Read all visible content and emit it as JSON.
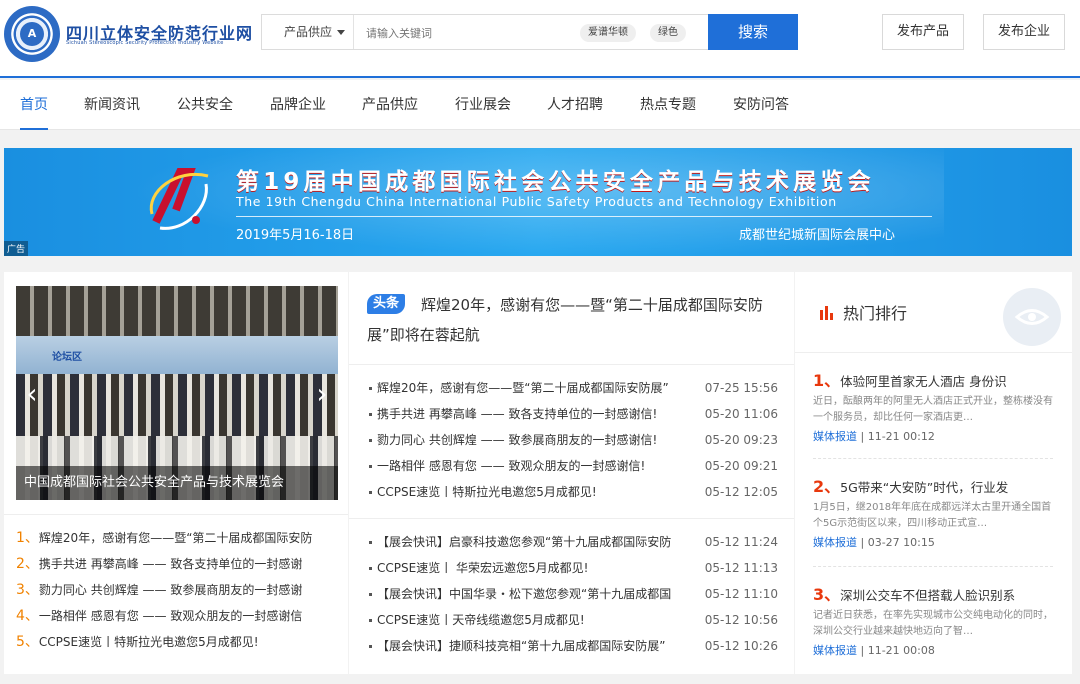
{
  "header": {
    "site_title": "四川立体安全防范行业网",
    "site_subtitle": "Sichuan Stereoscopic Security Protection Industry Website",
    "search": {
      "category": "产品供应",
      "placeholder": "请输入关键词",
      "tags": [
        "爱谱华顿",
        "绿色"
      ],
      "button": "搜索"
    },
    "publish_product": "发布产品",
    "publish_company": "发布企业"
  },
  "nav": {
    "items": [
      "首页",
      "新闻资讯",
      "公共安全",
      "品牌企业",
      "产品供应",
      "行业展会",
      "人才招聘",
      "热点专题",
      "安防问答"
    ],
    "active_index": 0
  },
  "banner": {
    "title": "第19届中国成都国际社会公共安全产品与技术展览会",
    "subtitle_en": "The 19th Chengdu China International Public Safety Products and Technology Exhibition",
    "date": "2019年5月16-18日",
    "venue": "成都世纪城新国际会展中心",
    "ad_label": "广告"
  },
  "feature": {
    "caption": "中国成都国际社会公共安全产品与技术展览会",
    "wall_text": "论坛区"
  },
  "rank_list": [
    {
      "num": "1、",
      "text": "辉煌20年，感谢有您——暨“第二十届成都国际安防"
    },
    {
      "num": "2、",
      "text": "携手共进 再攀高峰 —— 致各支持单位的一封感谢"
    },
    {
      "num": "3、",
      "text": "勠力同心 共创辉煌 —— 致参展商朋友的一封感谢"
    },
    {
      "num": "4、",
      "text": "一路相伴 感恩有您 —— 致观众朋友的一封感谢信"
    },
    {
      "num": "5、",
      "text": "CCPSE速览丨特斯拉光电邀您5月成都见!"
    }
  ],
  "headline": {
    "badge": "头条",
    "text": "辉煌20年，感谢有您——暨“第二十届成都国际安防展”即将在蓉起航"
  },
  "news_top": [
    {
      "title": "辉煌20年，感谢有您——暨“第二十届成都国际安防展”",
      "date": "07-25 15:56"
    },
    {
      "title": "携手共进 再攀高峰 —— 致各支持单位的一封感谢信!",
      "date": "05-20 11:06"
    },
    {
      "title": "勠力同心 共创辉煌 —— 致参展商朋友的一封感谢信!",
      "date": "05-20 09:23"
    },
    {
      "title": "一路相伴 感恩有您 —— 致观众朋友的一封感谢信!",
      "date": "05-20 09:21"
    },
    {
      "title": "CCPSE速览丨特斯拉光电邀您5月成都见!",
      "date": "05-12 12:05"
    }
  ],
  "news_bottom": [
    {
      "title": "【展会快讯】启豪科技邀您参观“第十九届成都国际安防",
      "date": "05-12 11:24"
    },
    {
      "title": "CCPSE速览丨 华荣宏远邀您5月成都见!",
      "date": "05-12 11:13"
    },
    {
      "title": "【展会快讯】中国华录・松下邀您参观“第十九届成都国",
      "date": "05-12 11:10"
    },
    {
      "title": "CCPSE速览丨天帝线缆邀您5月成都见!",
      "date": "05-12 10:56"
    },
    {
      "title": "【展会快讯】捷顺科技亮相“第十九届成都国际安防展”",
      "date": "05-12 10:26"
    }
  ],
  "hot": {
    "heading": "热门排行",
    "items": [
      {
        "num": "1、",
        "title": "体验阿里首家无人酒店 身份识",
        "desc": "近日，酝酿两年的阿里无人酒店正式开业，整栋楼没有一个服务员，却比任何一家酒店更…",
        "source": "媒体报道",
        "time": "11-21 00:12"
      },
      {
        "num": "2、",
        "title": "5G带来“大安防”时代，行业发",
        "desc": "1月5日，继2018年年底在成都远洋太古里开通全国首个5G示范街区以来，四川移动正式宣…",
        "source": "媒体报道",
        "time": "03-27 10:15"
      },
      {
        "num": "3、",
        "title": "深圳公交车不但搭载人脸识别系",
        "desc": "记者近日获悉，在率先实现城市公交纯电动化的同时，深圳公交行业越来越快地迈向了智…",
        "source": "媒体报道",
        "time": "11-21 00:08"
      }
    ]
  },
  "colors": {
    "accent": "#1f6fd8",
    "rank_orange": "#f08200",
    "hot_red": "#e8380d"
  }
}
